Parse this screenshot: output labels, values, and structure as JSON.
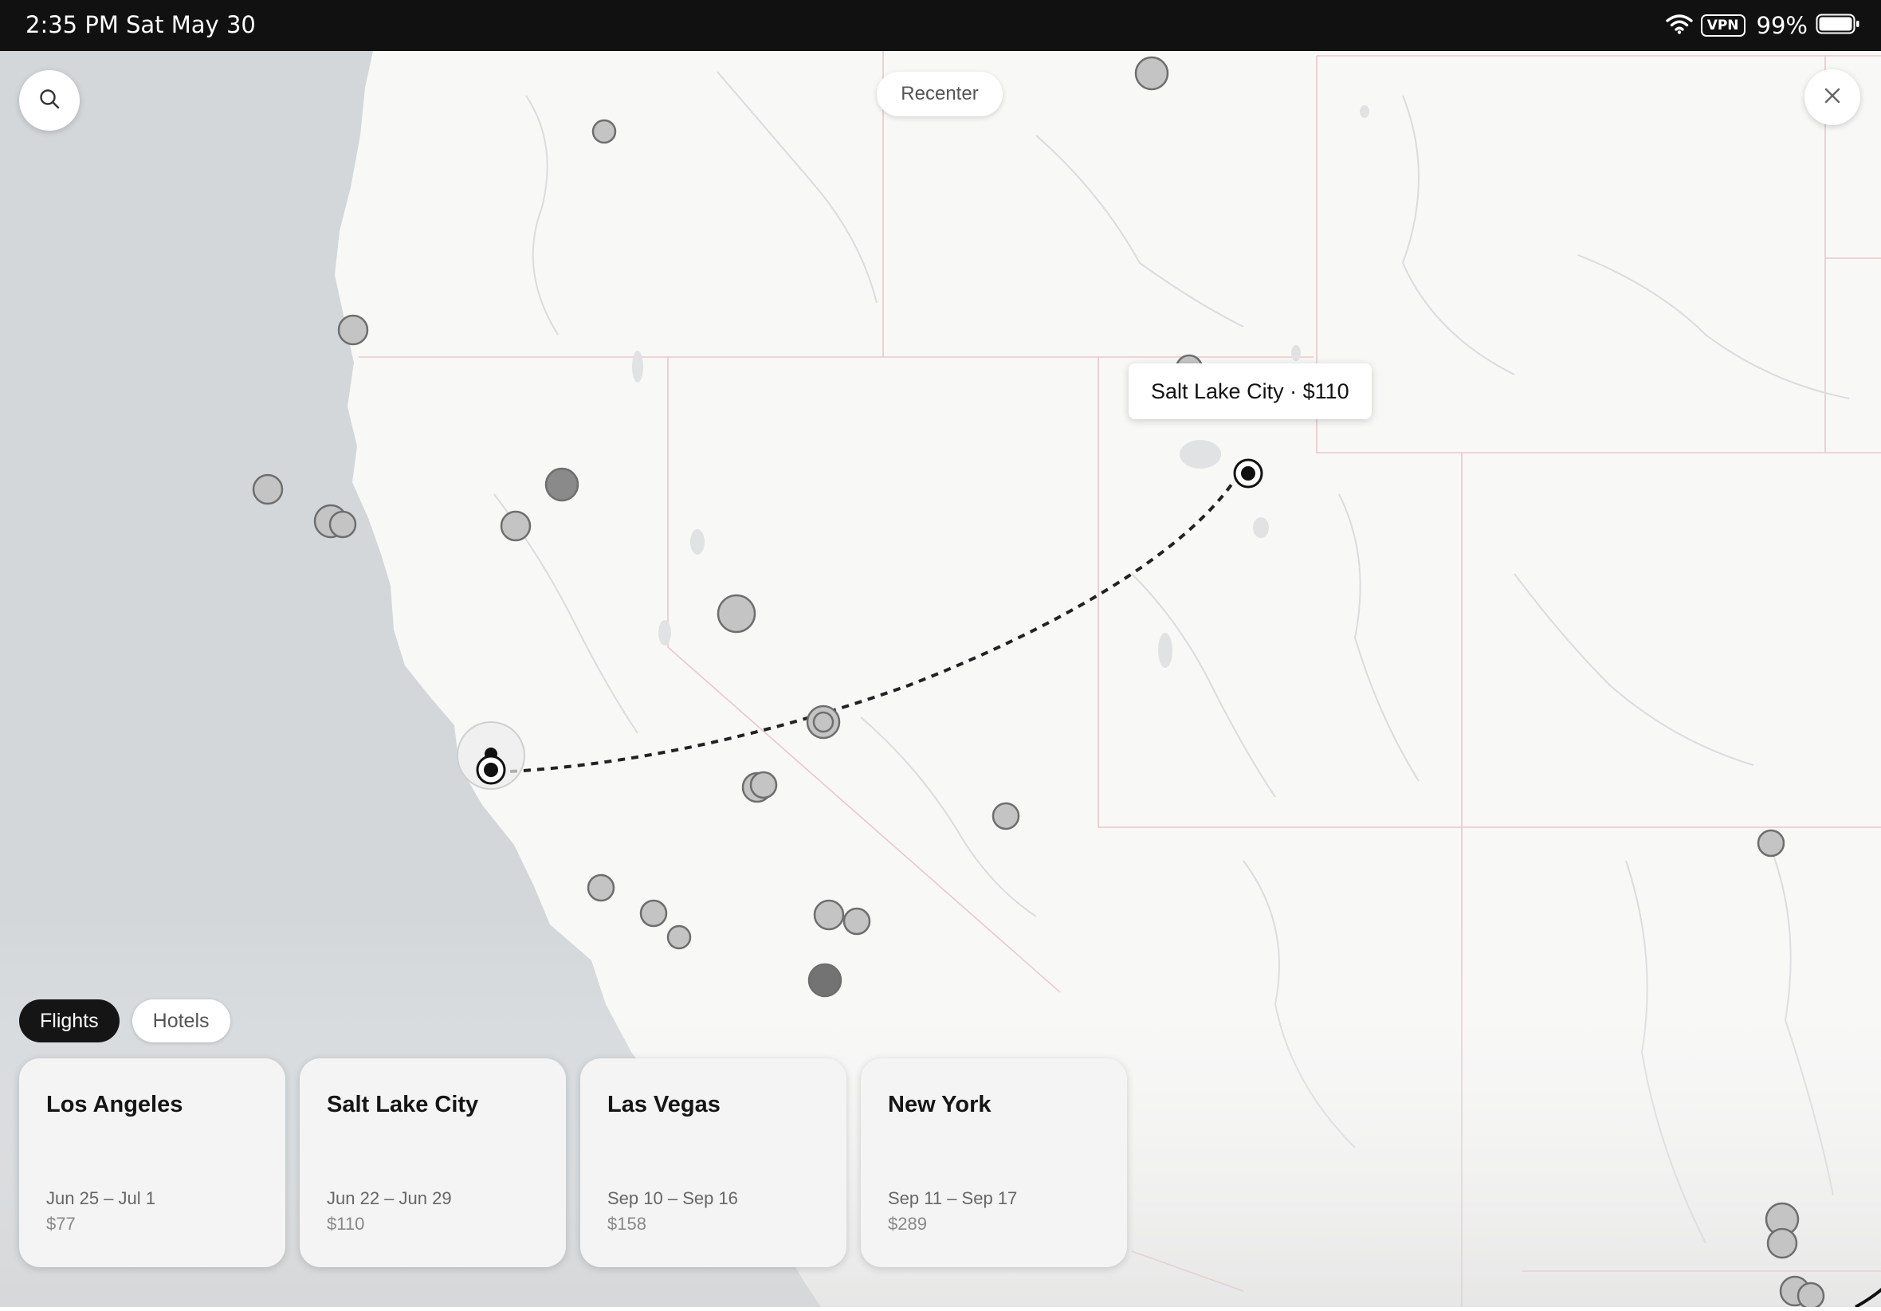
{
  "status_bar": {
    "time": "2:35 PM",
    "date": "Sat May 30",
    "vpn": "VPN",
    "battery": "99%",
    "icons": [
      "wifi-icon",
      "battery-icon"
    ]
  },
  "map": {
    "recenter_label": "Recenter",
    "tooltip": "Salt Lake City · $110",
    "icons": [
      "search-icon",
      "close-icon"
    ]
  },
  "tabs": [
    {
      "label": "Flights",
      "selected": true
    },
    {
      "label": "Hotels",
      "selected": false
    }
  ],
  "cards": [
    {
      "city": "Los Angeles",
      "dates": "Jun 25 – Jul 1",
      "price": "$77"
    },
    {
      "city": "Salt Lake City",
      "dates": "Jun 22 – Jun 29",
      "price": "$110"
    },
    {
      "city": "Las Vegas",
      "dates": "Sep 10 – Sep 16",
      "price": "$158"
    },
    {
      "city": "New York",
      "dates": "Sep 11 – Sep 17",
      "price": "$289"
    }
  ],
  "colors": {
    "ocean": "#d3d7da",
    "land": "#f8f8f7",
    "border": "#e7c9c9",
    "river": "#dadcdd",
    "marker": "#c4c4c4",
    "marker_dark": "#8a8a8a",
    "route": "#222222"
  }
}
